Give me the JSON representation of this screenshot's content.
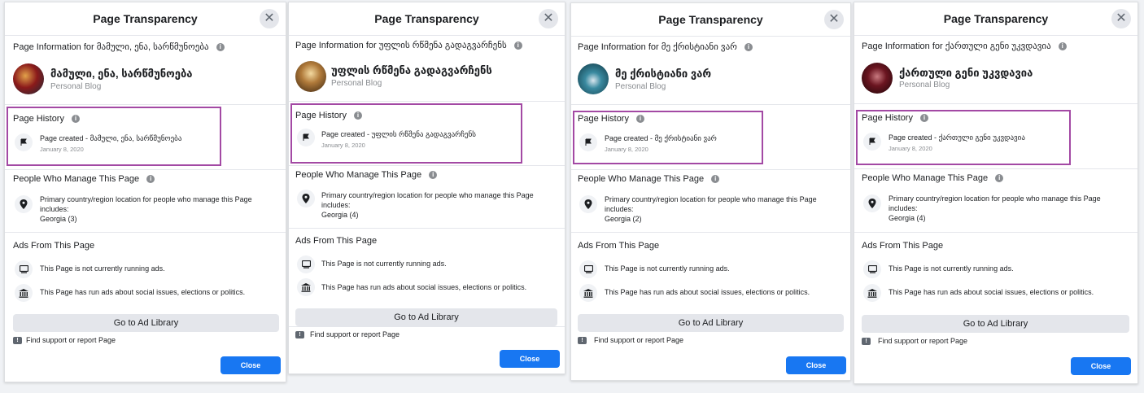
{
  "accent": "#1877f2",
  "highlight_color": "#a349a4",
  "common": {
    "title": "Page Transparency",
    "close_x": "✕",
    "page_info_prefix": "Page Information for",
    "category": "Personal Blog",
    "page_history": "Page History",
    "page_created_prefix": "Page created -",
    "created_date": "January 8, 2020",
    "people_manage": "People Who Manage This Page",
    "location_text_1": "Primary country/region location for people who manage this Page",
    "location_text_2": "includes:",
    "ads_from": "Ads From This Page",
    "not_running": "This Page is not currently running ads.",
    "has_run": "This Page has run ads about social issues, elections or politics.",
    "ad_library": "Go to Ad Library",
    "find_support": "Find support or report Page",
    "close": "Close"
  },
  "dialogs": [
    {
      "page_name": "მამული, ენა, სარწმუნოება",
      "managers": "Georgia (3)",
      "avatar_icon": "avatar-red-icon",
      "avatar_color": "#8b1a1a"
    },
    {
      "page_name": "უფლის რწმენა გადაგვარჩენს",
      "managers": "Georgia (4)",
      "avatar_icon": "avatar-icon-portrait",
      "avatar_color": "#b07a3a"
    },
    {
      "page_name": "მე ქრისტიანი ვარ",
      "managers": "Georgia (2)",
      "avatar_icon": "avatar-teal-icon",
      "avatar_color": "#1b5b6a"
    },
    {
      "page_name": "ქართული გენი უკვდავია",
      "managers": "Georgia (4)",
      "avatar_icon": "avatar-dark-red-icon",
      "avatar_color": "#3a0a0e"
    }
  ]
}
